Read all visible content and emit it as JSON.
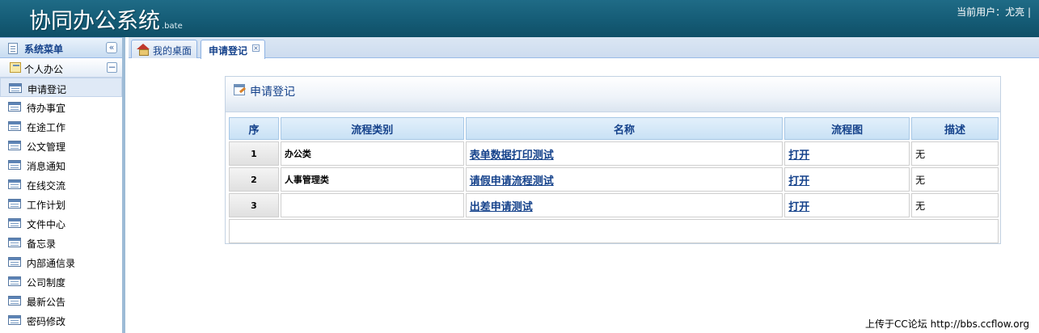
{
  "header": {
    "title": "协同办公系统",
    "suffix": ".bate",
    "current_user": "当前用户：尤亮 |"
  },
  "sidebar": {
    "title": "系统菜单",
    "collapse_glyph": "«",
    "group": {
      "label": "个人办公",
      "toggle_glyph": "−"
    },
    "items": [
      {
        "label": "申请登记",
        "active": true
      },
      {
        "label": "待办事宜"
      },
      {
        "label": "在途工作"
      },
      {
        "label": "公文管理"
      },
      {
        "label": "消息通知"
      },
      {
        "label": "在线交流"
      },
      {
        "label": "工作计划"
      },
      {
        "label": "文件中心"
      },
      {
        "label": "备忘录"
      },
      {
        "label": "内部通信录"
      },
      {
        "label": "公司制度"
      },
      {
        "label": "最新公告"
      },
      {
        "label": "密码修改"
      }
    ]
  },
  "tabs": [
    {
      "label": "我的桌面",
      "icon": "home-icon"
    },
    {
      "label": "申请登记",
      "active": true,
      "close_glyph": "×"
    }
  ],
  "panel": {
    "title": "申请登记",
    "columns": [
      "序",
      "流程类别",
      "名称",
      "流程图",
      "描述"
    ],
    "rows": [
      {
        "seq": "1",
        "category": "办公类",
        "name": "表单数据打印测试",
        "chart": "打开",
        "desc": "无"
      },
      {
        "seq": "2",
        "category": "人事管理类",
        "name": "请假申请流程测试",
        "chart": "打开",
        "desc": "无"
      },
      {
        "seq": "3",
        "category": "",
        "name": "出差申请测试",
        "chart": "打开",
        "desc": "无"
      }
    ]
  },
  "footer": {
    "watermark": "上传于CC论坛 http://bbs.ccflow.org"
  },
  "colors": {
    "header_bg": "#155c76",
    "link": "#15428b",
    "sidebar_border": "#9dbbd6"
  }
}
